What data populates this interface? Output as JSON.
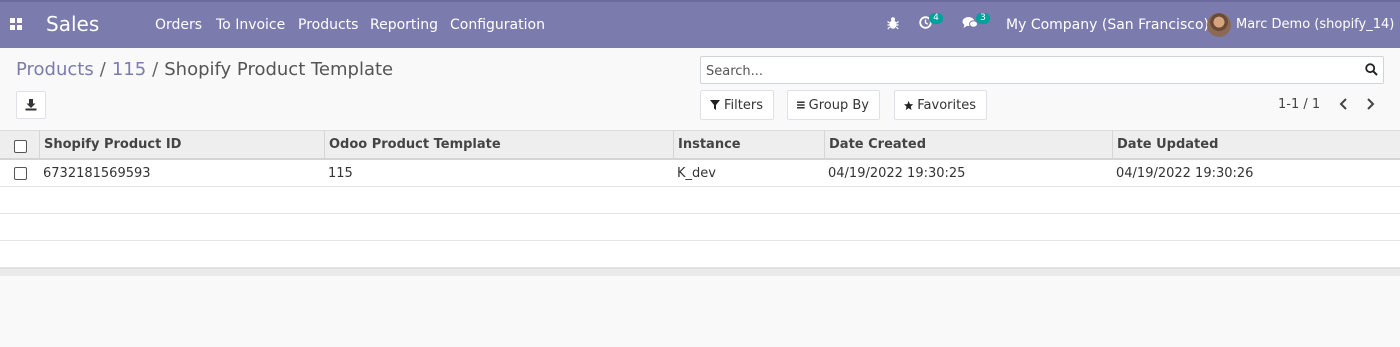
{
  "navbar": {
    "app_name": "Sales",
    "menu": [
      "Orders",
      "To Invoice",
      "Products",
      "Reporting",
      "Configuration"
    ],
    "activity_count": "4",
    "message_count": "3",
    "company": "My Company (San Francisco)",
    "user": "Marc Demo (shopify_14)"
  },
  "breadcrumb": {
    "items": [
      "Products",
      "115"
    ],
    "current": "Shopify Product Template",
    "separator": "/"
  },
  "search": {
    "placeholder": "Search..."
  },
  "filters": {
    "filters_label": "Filters",
    "group_by_label": "Group By",
    "favorites_label": "Favorites"
  },
  "pager": {
    "value": "1-1 / 1"
  },
  "table": {
    "columns": [
      "Shopify Product ID",
      "Odoo Product Template",
      "Instance",
      "Date Created",
      "Date Updated"
    ],
    "rows": [
      [
        "6732181569593",
        "115",
        "K_dev",
        "04/19/2022 19:30:25",
        "04/19/2022 19:30:26"
      ]
    ]
  },
  "colors": {
    "navbar": "#7c7bad",
    "link": "#7c7bad",
    "badge": "#00a09d"
  }
}
